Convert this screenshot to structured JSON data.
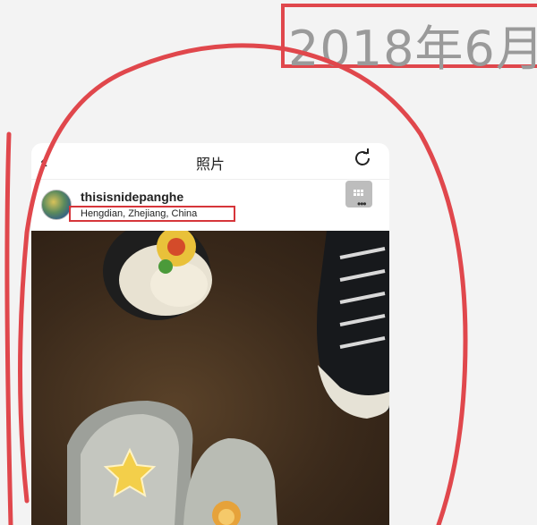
{
  "annotation": {
    "date_text": "2018年6月"
  },
  "nav": {
    "back_icon": "chevron-left-icon",
    "title": "照片",
    "refresh_icon": "refresh-icon"
  },
  "post": {
    "username": "thisisnidepanghe",
    "location": "Hengdian, Zhejiang, China",
    "more_icon": "more-icon"
  },
  "photo": {
    "description_icons": [
      "star-sticker-icon",
      "lion-sticker-icon"
    ]
  },
  "colors": {
    "annotation_red": "#e0474c",
    "background": "#f3f3f3",
    "date_gray": "#9a9a9a"
  }
}
